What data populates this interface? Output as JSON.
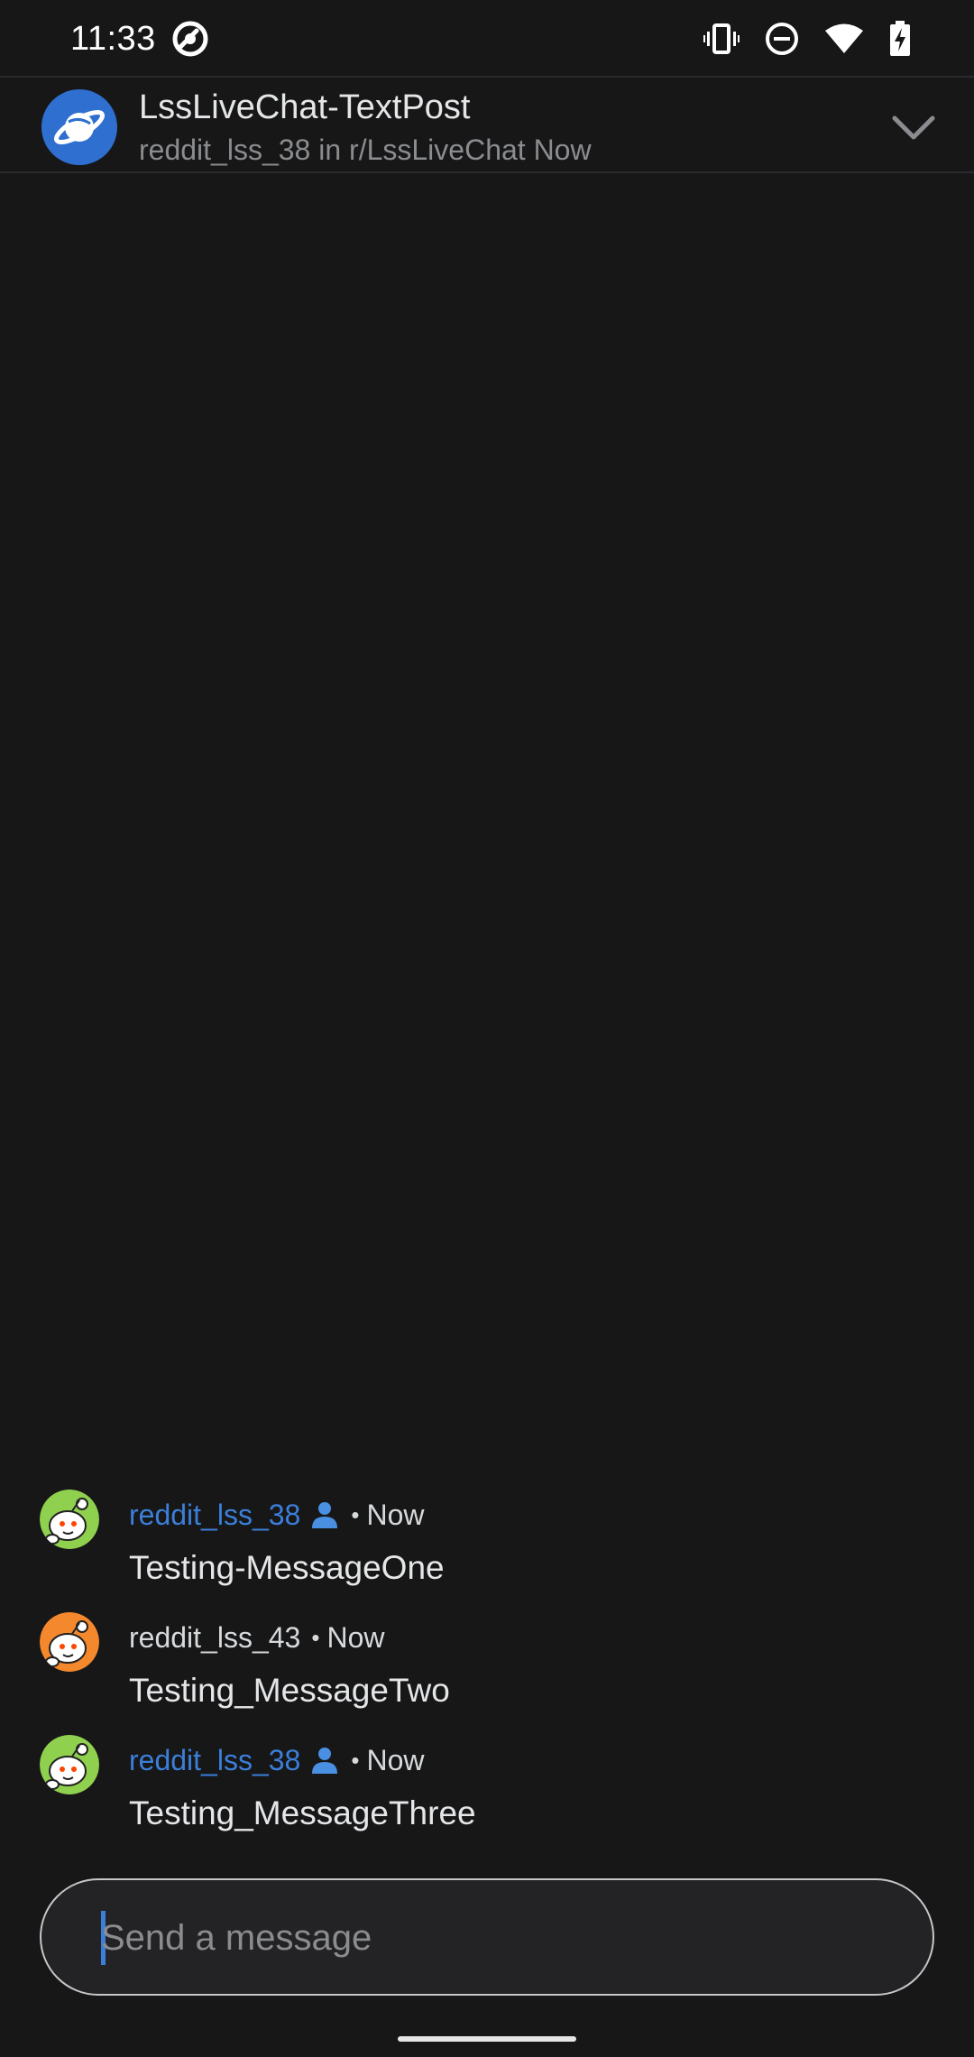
{
  "status_bar": {
    "time": "11:33"
  },
  "header": {
    "title": "LssLiveChat-TextPost",
    "subtitle": "reddit_lss_38 in r/LssLiveChat Now",
    "avatar_color": "#2f6fd0"
  },
  "messages": [
    {
      "author": "reddit_lss_38",
      "is_op": true,
      "separator": "•",
      "time": "Now",
      "body": "Testing-MessageOne",
      "avatar_color": "#8fd14f"
    },
    {
      "author": "reddit_lss_43",
      "is_op": false,
      "separator": "•",
      "time": "Now",
      "body": "Testing_MessageTwo",
      "avatar_color": "#f4882c"
    },
    {
      "author": "reddit_lss_38",
      "is_op": true,
      "separator": "•",
      "time": "Now",
      "body": "Testing_MessageThree",
      "avatar_color": "#8fd14f"
    }
  ],
  "composer": {
    "placeholder": "Send a message"
  },
  "colors": {
    "background": "#171718",
    "accent": "#3b7fd9",
    "text_primary": "#e4e6e8",
    "text_secondary": "#8a8c8f"
  }
}
